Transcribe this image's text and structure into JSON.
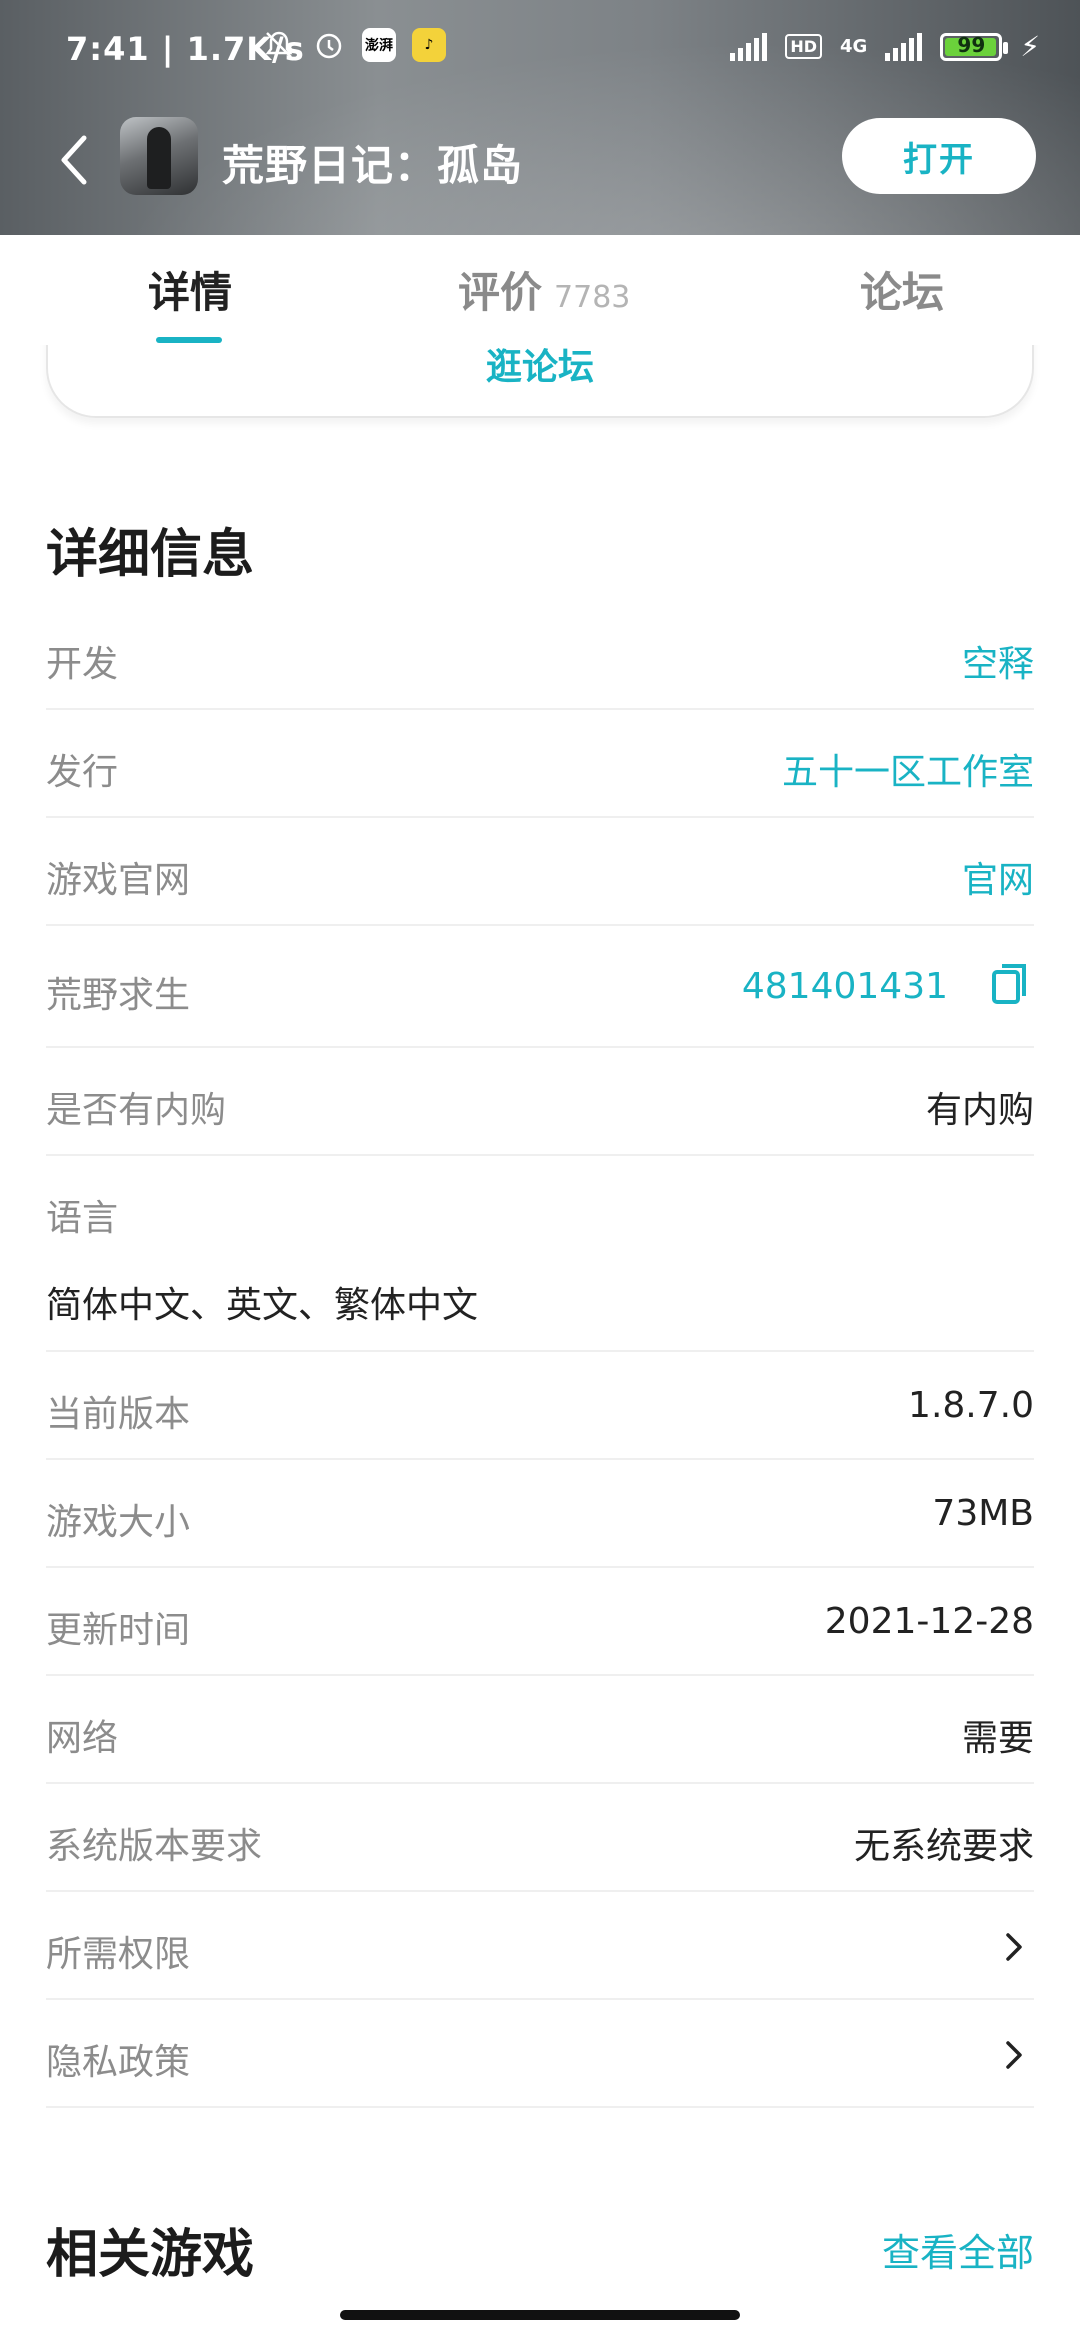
{
  "status_bar": {
    "time": "7:41 | 1.7K/s",
    "app_badge_1": "澎湃",
    "hd": "HD",
    "network": "4G",
    "battery": "99"
  },
  "app_bar": {
    "title": "荒野日记：孤岛",
    "open_label": "打开"
  },
  "tabs": [
    {
      "label": "详情",
      "count": ""
    },
    {
      "label": "评价",
      "count": "7783"
    },
    {
      "label": "论坛",
      "count": ""
    }
  ],
  "forum_link": "逛论坛",
  "details": {
    "title": "详细信息",
    "rows": [
      {
        "label": "开发",
        "value": "空释"
      },
      {
        "label": "发行",
        "value": "五十一区工作室"
      },
      {
        "label": "游戏官网",
        "value": "官网"
      },
      {
        "label": "荒野求生",
        "value": "481401431"
      },
      {
        "label": "是否有内购",
        "value": "有内购"
      },
      {
        "label": "语言",
        "value": "简体中文、英文、繁体中文"
      },
      {
        "label": "当前版本",
        "value": "1.8.7.0"
      },
      {
        "label": "游戏大小",
        "value": "73MB"
      },
      {
        "label": "更新时间",
        "value": "2021-12-28"
      },
      {
        "label": "网络",
        "value": "需要"
      },
      {
        "label": "系统版本要求",
        "value": "无系统要求"
      },
      {
        "label": "所需权限",
        "value": ""
      },
      {
        "label": "隐私政策",
        "value": ""
      }
    ]
  },
  "related": {
    "title": "相关游戏",
    "view_all": "查看全部"
  },
  "colors": {
    "accent": "#19b3c4",
    "label_gray": "#8c8c8c"
  }
}
